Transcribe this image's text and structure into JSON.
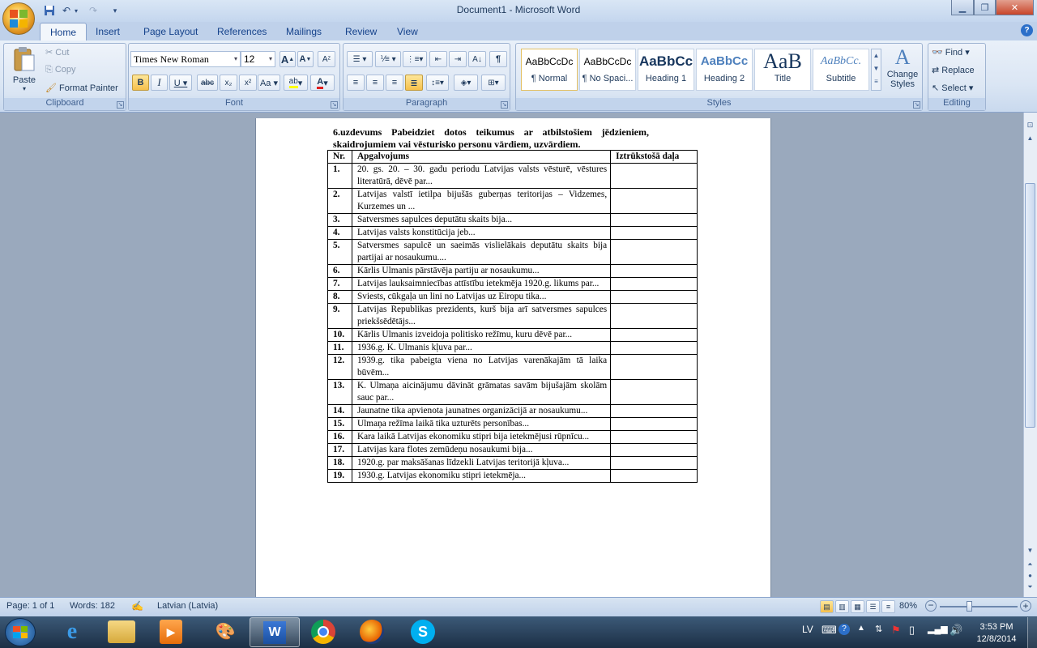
{
  "window": {
    "title": "Document1 - Microsoft Word"
  },
  "tabs": [
    "Home",
    "Insert",
    "Page Layout",
    "References",
    "Mailings",
    "Review",
    "View"
  ],
  "clipboard": {
    "paste": "Paste",
    "cut": "Cut",
    "copy": "Copy",
    "format_painter": "Format Painter",
    "label": "Clipboard"
  },
  "font": {
    "family": "Times New Roman",
    "size": "12",
    "label": "Font"
  },
  "paragraph": {
    "label": "Paragraph"
  },
  "styles": {
    "items": [
      {
        "preview": "AaBbCcDc",
        "name": "¶ Normal"
      },
      {
        "preview": "AaBbCcDc",
        "name": "¶ No Spaci..."
      },
      {
        "preview": "AaBbCc",
        "name": "Heading 1"
      },
      {
        "preview": "AaBbCc",
        "name": "Heading 2"
      },
      {
        "preview": "AaB",
        "name": "Title"
      },
      {
        "preview": "AaBbCc.",
        "name": "Subtitle"
      }
    ],
    "change_styles": "Change Styles",
    "label": "Styles"
  },
  "editing": {
    "find": "Find",
    "replace": "Replace",
    "select": "Select",
    "label": "Editing"
  },
  "document": {
    "heading": "6.uzdevums Pabeidziet dotos teikumus ar atbilstošiem jēdzieniem, skaidrojumiem vai vēsturisko personu vārdiem, uzvārdiem.",
    "columns": [
      "Nr.",
      "Apgalvojums",
      "Iztrūkstošā daļa"
    ],
    "rows": [
      {
        "n": "1.",
        "q": "20. gs. 20. – 30. gadu periodu Latvijas valsts vēsturē, vēstures literatūrā, dēvē par..."
      },
      {
        "n": "2.",
        "q": "Latvijas valstī ietilpa bijušās guberņas teritorijas – Vidzemes, Kurzemes un ..."
      },
      {
        "n": "3.",
        "q": "Satversmes sapulces deputātu skaits bija..."
      },
      {
        "n": "4.",
        "q": "Latvijas valsts konstitūcija jeb..."
      },
      {
        "n": "5.",
        "q": "Satversmes sapulcē un saeimās vislielākais deputātu skaits bija partijai ar nosaukumu...."
      },
      {
        "n": "6.",
        "q": "Kārlis Ulmanis pārstāvēja partiju ar nosaukumu..."
      },
      {
        "n": "7.",
        "q": "Latvijas lauksaimniecības attīstību ietekmēja 1920.g. likums par..."
      },
      {
        "n": "8.",
        "q": "Sviests, cūkgaļa un lini no Latvijas uz Eiropu tika..."
      },
      {
        "n": "9.",
        "q": "Latvijas Republikas prezidents, kurš bija arī satversmes sapulces priekšsēdētājs..."
      },
      {
        "n": "10.",
        "q": "Kārlis Ulmanis izveidoja politisko režīmu, kuru dēvē par..."
      },
      {
        "n": "11.",
        "q": "1936.g. K. Ulmanis kļuva par..."
      },
      {
        "n": "12.",
        "q": "1939.g. tika pabeigta viena no Latvijas varenākajām tā laika būvēm..."
      },
      {
        "n": "13.",
        "q": "K. Ulmaņa aicinājumu dāvināt grāmatas savām bijušajām skolām sauc par..."
      },
      {
        "n": "14.",
        "q": "Jaunatne tika apvienota jaunatnes organizācijā ar nosaukumu..."
      },
      {
        "n": "15.",
        "q": "Ulmaņa režīma laikā tika uzturēts personības..."
      },
      {
        "n": "16.",
        "q": "Kara laikā Latvijas ekonomiku stipri bija ietekmējusi rūpnīcu..."
      },
      {
        "n": "17.",
        "q": "Latvijas kara flotes zemūdeņu nosaukumi bija..."
      },
      {
        "n": "18.",
        "q": "1920.g. par maksāšanas līdzekli Latvijas teritorijā kļuva..."
      },
      {
        "n": "19.",
        "q": "1930.g. Latvijas ekonomiku stipri ietekmēja..."
      }
    ]
  },
  "status": {
    "page": "Page: 1 of 1",
    "words": "Words: 182",
    "language": "Latvian (Latvia)",
    "zoom": "80%"
  },
  "taskbar": {
    "lang": "LV",
    "time": "3:53 PM",
    "date": "12/8/2014"
  }
}
